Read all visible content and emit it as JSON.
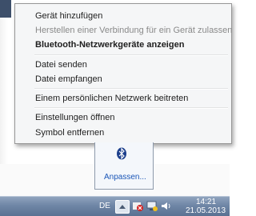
{
  "context_menu": {
    "items": [
      {
        "label": "Gerät hinzufügen",
        "enabled": true,
        "bold": false
      },
      {
        "label": "Herstellen einer Verbindung für ein Gerät zulassen",
        "enabled": false,
        "bold": false
      },
      {
        "label": "Bluetooth-Netzwerkgeräte anzeigen",
        "enabled": true,
        "bold": true
      },
      {
        "label": "Datei senden",
        "enabled": true,
        "bold": false
      },
      {
        "label": "Datei empfangen",
        "enabled": true,
        "bold": false
      },
      {
        "label": "Einem persönlichen Netzwerk beitreten",
        "enabled": true,
        "bold": false
      },
      {
        "label": "Einstellungen öffnen",
        "enabled": true,
        "bold": false
      },
      {
        "label": "Symbol entfernen",
        "enabled": true,
        "bold": false
      }
    ]
  },
  "tray_popup": {
    "icon": "bluetooth-icon",
    "customize_label": "Anpassen..."
  },
  "taskbar": {
    "language": "DE",
    "tray_icons": [
      "show-hidden-icons-icon",
      "action-center-icon",
      "network-icon",
      "volume-icon"
    ],
    "time": "14:21",
    "date": "21.05.2013"
  },
  "colors": {
    "menu_bg": "#f5f6f7",
    "disabled_text": "#8a8a8a",
    "link": "#1a56b7",
    "taskbar": "#6f86a6"
  }
}
